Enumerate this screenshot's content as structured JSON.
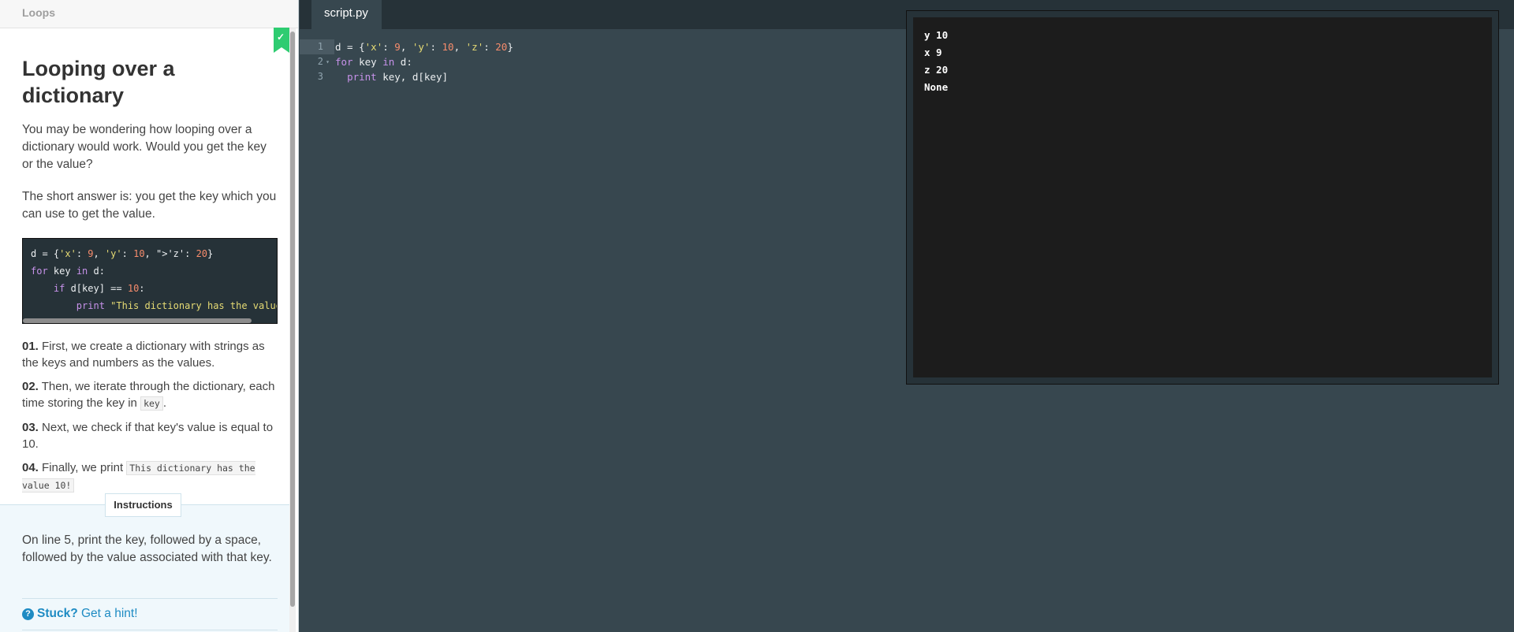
{
  "course": {
    "title": "Loops"
  },
  "bookmark": {
    "icon": "check-icon",
    "glyph": "✓",
    "color": "#2ecc71"
  },
  "lesson": {
    "title": "Looping over a dictionary",
    "paragraphs": [
      "You may be wondering how looping over a dictionary would work. Would you get the key or the value?",
      "The short answer is: you get the key which you can use to get the value."
    ],
    "code_example": [
      "d = {'x': 9, 'y': 10, 'z': 20}",
      "for key in d:",
      "    if d[key] == 10:",
      "        print \"This dictionary has the value"
    ],
    "steps": [
      {
        "num": "01.",
        "text": "First, we create a dictionary with strings as the keys and numbers as the values."
      },
      {
        "num": "02.",
        "text_before": "Then, we iterate through the dictionary, each time storing the key in ",
        "code": "key",
        "text_after": "."
      },
      {
        "num": "03.",
        "text": "Next, we check if that key's value is equal to 10."
      },
      {
        "num": "04.",
        "text_before": "Finally, we print ",
        "code": "This dictionary has the value 10!",
        "text_after": ""
      }
    ]
  },
  "instructions": {
    "tab_label": "Instructions",
    "text": "On line 5, print the key, followed by a space, followed by the value associated with that key.",
    "hint_strong": "Stuck?",
    "hint_link": "Get a hint!",
    "hint_icon": "question-icon"
  },
  "editor": {
    "file_tab": "script.py",
    "active_line": 1,
    "lines": [
      {
        "n": "1",
        "tokens": [
          [
            "plain",
            "d = {"
          ],
          [
            "str",
            "'x'"
          ],
          [
            "plain",
            ": "
          ],
          [
            "num-t",
            "9"
          ],
          [
            "plain",
            ", "
          ],
          [
            "str",
            "'y'"
          ],
          [
            "plain",
            ": "
          ],
          [
            "num-t",
            "10"
          ],
          [
            "plain",
            ", "
          ],
          [
            "str",
            "'z'"
          ],
          [
            "plain",
            ": "
          ],
          [
            "num-t",
            "20"
          ],
          [
            "plain",
            "}"
          ]
        ]
      },
      {
        "n": "2",
        "tokens": [
          [
            "kw",
            "for"
          ],
          [
            "plain",
            " key "
          ],
          [
            "kw",
            "in"
          ],
          [
            "plain",
            " d:"
          ]
        ]
      },
      {
        "n": "3",
        "tokens": [
          [
            "plain",
            "  "
          ],
          [
            "kw",
            "print"
          ],
          [
            "plain",
            " key, d[key]"
          ]
        ]
      }
    ]
  },
  "console": {
    "output": [
      "y 10",
      "x 9",
      "z 20",
      "None"
    ]
  }
}
